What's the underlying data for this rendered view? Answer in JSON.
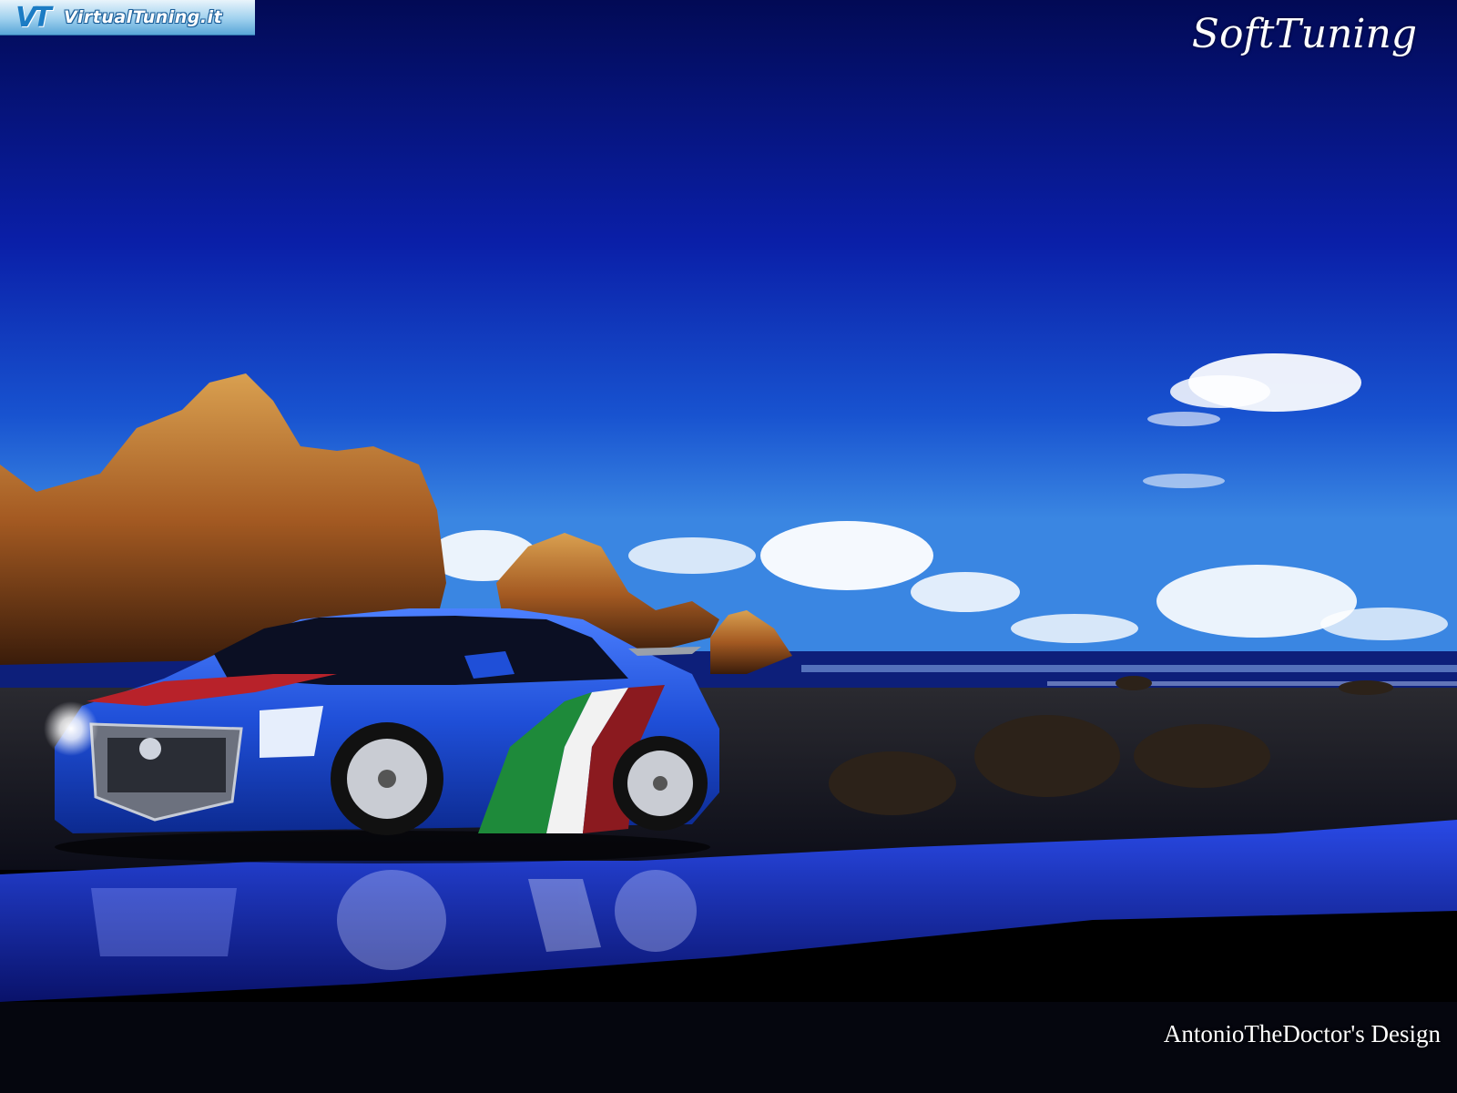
{
  "header": {
    "site_logo": {
      "icon": "vt-logo-icon",
      "label": "VirtualTuning.it"
    },
    "brand_watermark": "SoftTuning"
  },
  "footer": {
    "designer_credit": "AntonioTheDoctor's Design"
  },
  "scene": {
    "subject": "sedan-car",
    "setting": "beach-at-dusk",
    "colors": {
      "sky_top": "#030b5e",
      "sky_horizon": "#2a6fd6",
      "car_body": "#1f4fd8",
      "stripe_green": "#1e8a3a",
      "stripe_white": "#f2f2f2",
      "stripe_red": "#b8222a",
      "rock": "#b0652a",
      "sand": "#1b1d2a",
      "water_reflection": "#1b38e0"
    }
  }
}
